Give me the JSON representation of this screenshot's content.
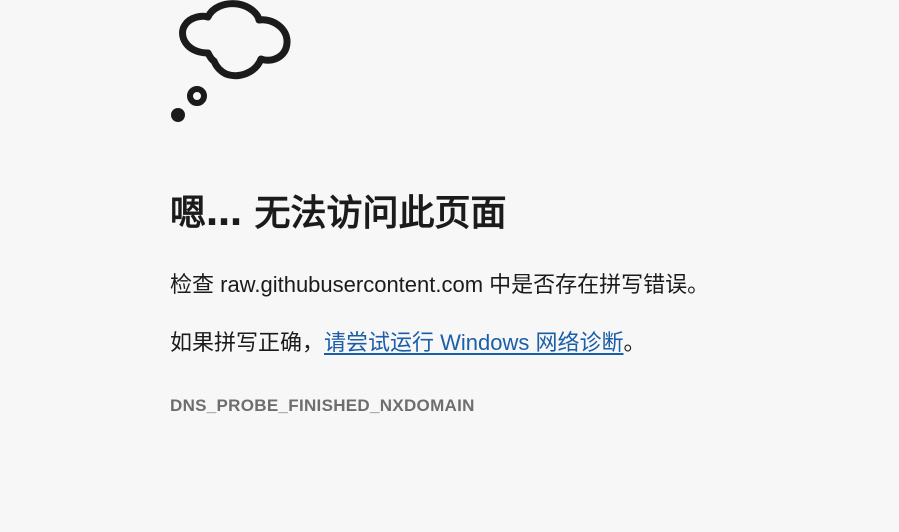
{
  "error": {
    "icon": "thought-bubble-icon",
    "title": "嗯… 无法访问此页面",
    "check_prefix": "检查 ",
    "host": "raw.githubusercontent.com",
    "check_suffix": " 中是否存在拼写错误。",
    "spelling_prefix": "如果拼写正确，",
    "diagnostics_link": "请尝试运行 Windows 网络诊断",
    "spelling_suffix": "。",
    "code": "DNS_PROBE_FINISHED_NXDOMAIN"
  },
  "colors": {
    "background": "#f7f7f7",
    "text": "#1b1b1b",
    "link": "#1a5ea8",
    "code": "#6e6e6e"
  }
}
